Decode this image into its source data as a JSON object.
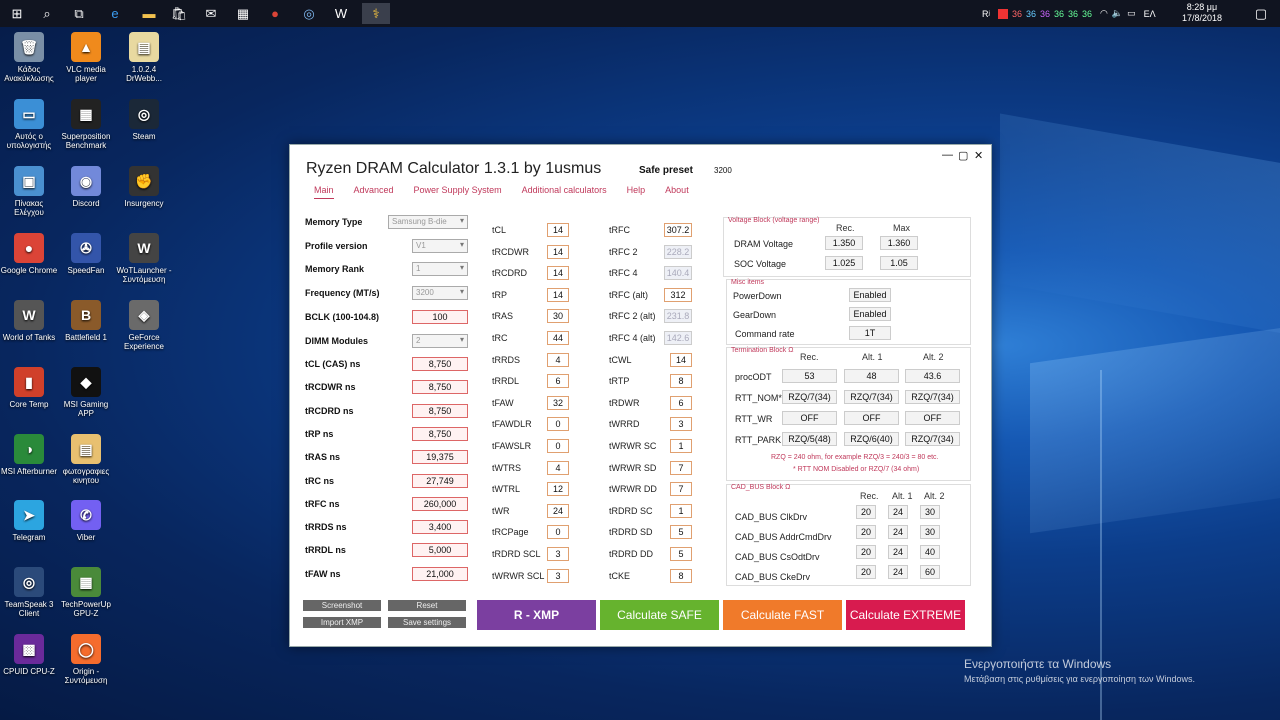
{
  "taskbar": {
    "tray_icons": [
      "Rʲ",
      "36",
      "36",
      "36",
      "36",
      "36",
      "36"
    ],
    "lang": "ΕΛ",
    "time": "8:28 μμ",
    "date": "17/8/2018"
  },
  "desktop": {
    "icons": [
      {
        "label": "Κάδος Ανακύκλωσης",
        "color": "#7a8fa6",
        "glyph": "🗑"
      },
      {
        "label": "VLC media player",
        "color": "#f08a1c",
        "glyph": "▲"
      },
      {
        "label": "1.0.2.4 DrWebb...",
        "color": "#e8d9a0",
        "glyph": "▤"
      },
      {
        "label": "Αυτός ο υπολογιστής",
        "color": "#3b8fd6",
        "glyph": "▭"
      },
      {
        "label": "Superposition Benchmark",
        "color": "#222",
        "glyph": "▦"
      },
      {
        "label": "Steam",
        "color": "#1b2838",
        "glyph": "◎"
      },
      {
        "label": "Πίνακας Ελέγχου",
        "color": "#4a90d0",
        "glyph": "▣"
      },
      {
        "label": "Discord",
        "color": "#7289da",
        "glyph": "◉"
      },
      {
        "label": "Insurgency",
        "color": "#333",
        "glyph": "✊"
      },
      {
        "label": "Google Chrome",
        "color": "#db4437",
        "glyph": "●"
      },
      {
        "label": "SpeedFan",
        "color": "#3355aa",
        "glyph": "✇"
      },
      {
        "label": "WoTLauncher - Συντόμευση",
        "color": "#444",
        "glyph": "W"
      },
      {
        "label": "World of Tanks",
        "color": "#555",
        "glyph": "W"
      },
      {
        "label": "Battlefield 1",
        "color": "#8a5a2a",
        "glyph": "B"
      },
      {
        "label": "GeForce Experience",
        "color": "#6a6a6a",
        "glyph": "◈"
      },
      {
        "label": "Core Temp",
        "color": "#d0402a",
        "glyph": "▮"
      },
      {
        "label": "MSI Gaming APP",
        "color": "#111",
        "glyph": "◆"
      },
      {
        "label": "MSI Afterburner",
        "color": "#2a8a3a",
        "glyph": "◑"
      },
      {
        "label": "φωτογραφιες κινητου",
        "color": "#e8c070",
        "glyph": "▤"
      },
      {
        "label": "Telegram",
        "color": "#2ca5e0",
        "glyph": "➤"
      },
      {
        "label": "Viber",
        "color": "#7360f2",
        "glyph": "✆"
      },
      {
        "label": "TeamSpeak 3 Client",
        "color": "#2b4a7a",
        "glyph": "◎"
      },
      {
        "label": "TechPowerUp GPU-Z",
        "color": "#4a8a3a",
        "glyph": "▦"
      },
      {
        "label": "CPUID CPU-Z",
        "color": "#6a2a9a",
        "glyph": "▩"
      },
      {
        "label": "Origin - Συντόμευση",
        "color": "#f56c2d",
        "glyph": "◯"
      }
    ]
  },
  "watermark": {
    "line1": "Ενεργοποιήστε τα Windows",
    "line2": "Μετάβαση στις ρυθμίσεις για ενεργοποίηση των Windows."
  },
  "window": {
    "title": "Ryzen DRAM Calculator 1.3.1 by 1usmus",
    "preset_label": "Safe preset",
    "preset_value": "3200",
    "tabs": [
      "Main",
      "Advanced",
      "Power Supply System",
      "Additional calculators",
      "Help",
      "About"
    ],
    "settings": [
      {
        "label": "Memory Type",
        "value": "Samsung B-die"
      },
      {
        "label": "Profile version",
        "value": "V1"
      },
      {
        "label": "Memory Rank",
        "value": "1"
      },
      {
        "label": "Frequency (MT/s)",
        "value": "3200"
      }
    ],
    "bclk": {
      "label": "BCLK (100-104.8)",
      "value": "100"
    },
    "dimm": {
      "label": "DIMM Modules",
      "value": "2"
    },
    "ns_timings": [
      {
        "label": "tCL (CAS) ns",
        "value": "8,750"
      },
      {
        "label": "tRCDWR ns",
        "value": "8,750"
      },
      {
        "label": "tRCDRD ns",
        "value": "8,750"
      },
      {
        "label": "tRP ns",
        "value": "8,750"
      },
      {
        "label": "tRAS ns",
        "value": "19,375"
      },
      {
        "label": "tRC ns",
        "value": "27,749"
      },
      {
        "label": "tRFC ns",
        "value": "260,000"
      },
      {
        "label": "tRRDS ns",
        "value": "3,400"
      },
      {
        "label": "tRRDL ns",
        "value": "5,000"
      },
      {
        "label": "tFAW ns",
        "value": "21,000"
      }
    ],
    "timings_col1": [
      {
        "label": "tCL",
        "value": "14"
      },
      {
        "label": "tRCDWR",
        "value": "14"
      },
      {
        "label": "tRCDRD",
        "value": "14"
      },
      {
        "label": "tRP",
        "value": "14"
      },
      {
        "label": "tRAS",
        "value": "30"
      },
      {
        "label": "tRC",
        "value": "44"
      },
      {
        "label": "tRRDS",
        "value": "4"
      },
      {
        "label": "tRRDL",
        "value": "6"
      },
      {
        "label": "tFAW",
        "value": "32"
      },
      {
        "label": "tFAWDLR",
        "value": "0"
      },
      {
        "label": "tFAWSLR",
        "value": "0"
      },
      {
        "label": "tWTRS",
        "value": "4"
      },
      {
        "label": "tWTRL",
        "value": "12"
      },
      {
        "label": "tWR",
        "value": "24"
      },
      {
        "label": "tRCPage",
        "value": "0"
      },
      {
        "label": "tRDRD SCL",
        "value": "3"
      },
      {
        "label": "tWRWR SCL",
        "value": "3"
      }
    ],
    "timings_col2": [
      {
        "label": "tRFC",
        "value": "307.2"
      },
      {
        "label": "tRFC 2",
        "value": "228.2"
      },
      {
        "label": "tRFC 4",
        "value": "140.4"
      },
      {
        "label": "tRFC (alt)",
        "value": "312"
      },
      {
        "label": "tRFC 2 (alt)",
        "value": "231.8"
      },
      {
        "label": "tRFC 4 (alt)",
        "value": "142.6"
      },
      {
        "label": "tCWL",
        "value": "14"
      },
      {
        "label": "tRTP",
        "value": "8"
      },
      {
        "label": "tRDWR",
        "value": "6"
      },
      {
        "label": "tWRRD",
        "value": "3"
      },
      {
        "label": "tWRWR SC",
        "value": "1"
      },
      {
        "label": "tWRWR SD",
        "value": "7"
      },
      {
        "label": "tWRWR DD",
        "value": "7"
      },
      {
        "label": "tRDRD SC",
        "value": "1"
      },
      {
        "label": "tRDRD SD",
        "value": "5"
      },
      {
        "label": "tRDRD DD",
        "value": "5"
      },
      {
        "label": "tCKE",
        "value": "8"
      }
    ],
    "voltage": {
      "title": "Voltage Block (voltage range)",
      "head_rec": "Rec.",
      "head_max": "Max",
      "rows": [
        {
          "label": "DRAM Voltage",
          "rec": "1.350",
          "max": "1.360"
        },
        {
          "label": "SOC Voltage",
          "rec": "1.025",
          "max": "1.05"
        }
      ]
    },
    "misc": {
      "title": "Misc items",
      "rows": [
        {
          "label": "PowerDown",
          "value": "Enabled"
        },
        {
          "label": "GearDown",
          "value": "Enabled"
        },
        {
          "label": "Command rate",
          "value": "1T"
        }
      ]
    },
    "termination": {
      "title": "Termination Block Ω",
      "heads": [
        "Rec.",
        "Alt. 1",
        "Alt. 2"
      ],
      "rows": [
        {
          "label": "procODT",
          "v": [
            "53",
            "48",
            "43.6"
          ]
        },
        {
          "label": "RTT_NOM*",
          "v": [
            "RZQ/7(34)",
            "RZQ/7(34)",
            "RZQ/7(34)"
          ]
        },
        {
          "label": "RTT_WR",
          "v": [
            "OFF",
            "OFF",
            "OFF"
          ]
        },
        {
          "label": "RTT_PARK",
          "v": [
            "RZQ/5(48)",
            "RZQ/6(40)",
            "RZQ/7(34)"
          ]
        }
      ],
      "note1": "RZQ = 240 ohm, for example RZQ/3 = 240/3 = 80 etc.",
      "note2": "* RTT NOM Disabled or RZQ/7 (34 ohm)"
    },
    "cadbus": {
      "title": "CAD_BUS Block Ω",
      "heads": [
        "Rec.",
        "Alt. 1",
        "Alt. 2"
      ],
      "rows": [
        {
          "label": "CAD_BUS ClkDrv",
          "v": [
            "20",
            "24",
            "30"
          ]
        },
        {
          "label": "CAD_BUS AddrCmdDrv",
          "v": [
            "20",
            "24",
            "30"
          ]
        },
        {
          "label": "CAD_BUS CsOdtDrv",
          "v": [
            "20",
            "24",
            "40"
          ]
        },
        {
          "label": "CAD_BUS CkeDrv",
          "v": [
            "20",
            "24",
            "60"
          ]
        }
      ]
    },
    "small_buttons": {
      "screenshot": "Screenshot",
      "reset": "Reset",
      "import_xmp": "Import XMP",
      "save": "Save settings"
    },
    "big_buttons": [
      {
        "label": "R - XMP",
        "color": "#7b3fa0"
      },
      {
        "label": "Calculate SAFE",
        "color": "#66b32e"
      },
      {
        "label": "Calculate FAST",
        "color": "#f07a2a"
      },
      {
        "label": "Calculate EXTREME",
        "color": "#d81b4f"
      }
    ]
  }
}
